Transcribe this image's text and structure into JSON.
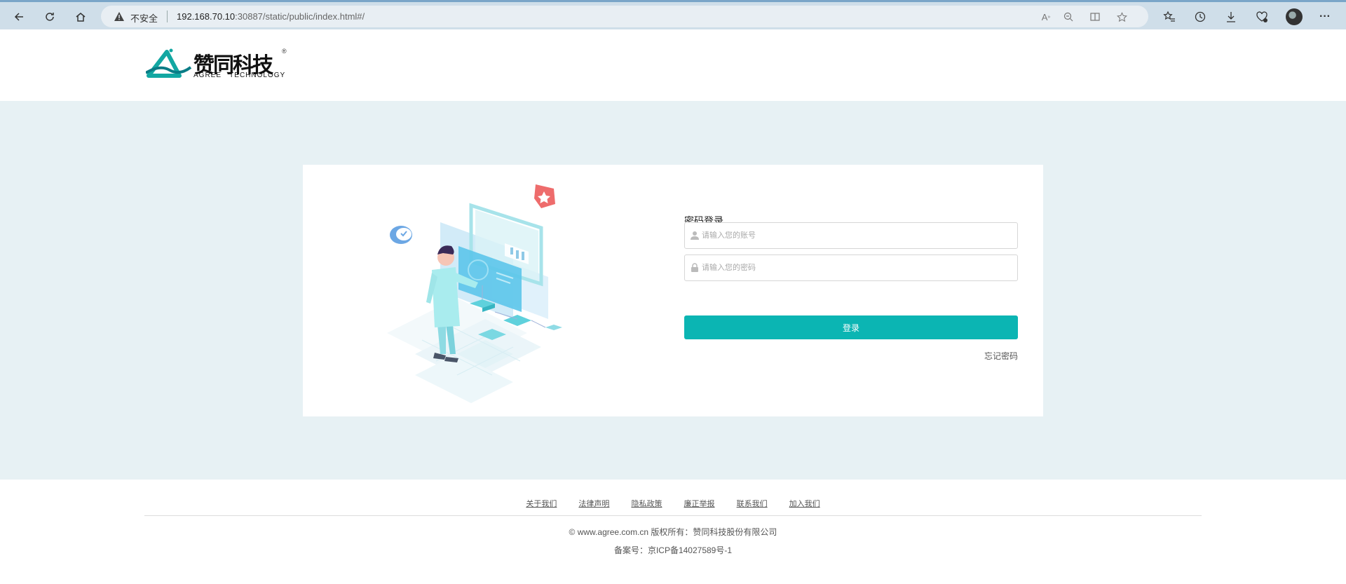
{
  "browser": {
    "security_label": "不安全",
    "url_host": "192.168.70.10",
    "url_rest": ":30887/static/public/index.html#/",
    "icons": [
      "back-icon",
      "refresh-icon",
      "home-icon",
      "read-aloud-icon",
      "zoom-out-icon",
      "split-screen-icon",
      "favorite-star-icon",
      "favorites-icon",
      "history-icon",
      "download-icon",
      "browser-essentials-icon",
      "profile-avatar",
      "more-icon"
    ]
  },
  "brand": {
    "name_cn": "赞同科技",
    "name_en": "AGREE   TECHNOLOGY",
    "registered": "®",
    "accent": "#0bb5b3"
  },
  "login": {
    "title": "密码登录",
    "account_placeholder": "请输入您的账号",
    "password_placeholder": "请输入您的密码",
    "submit_label": "登录",
    "forgot_label": "忘记密码"
  },
  "footer": {
    "links": [
      "关于我们",
      "法律声明",
      "隐私政策",
      "廉正举报",
      "联系我们",
      "加入我们"
    ],
    "copyright": "© www.agree.com.cn 版权所有：赞同科技股份有限公司",
    "icp": "备案号：京ICP备14027589号-1"
  }
}
